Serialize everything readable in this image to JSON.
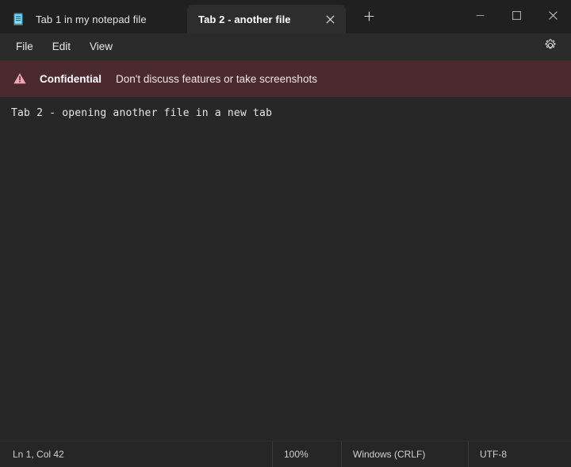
{
  "window": {
    "app_icon": "notepad-icon",
    "controls": {
      "minimize": "minimize-icon",
      "maximize": "maximize-icon",
      "close": "close-icon"
    }
  },
  "tabs": {
    "items": [
      {
        "label": "Tab 1 in my notepad file",
        "active": false
      },
      {
        "label": "Tab 2 - another file",
        "active": true
      }
    ],
    "close_icon": "close-icon",
    "new_tab_icon": "plus-icon",
    "new_tab_label": "+"
  },
  "menubar": {
    "items": [
      {
        "label": "File"
      },
      {
        "label": "Edit"
      },
      {
        "label": "View"
      }
    ],
    "settings_icon": "gear-icon"
  },
  "banner": {
    "icon": "warning-triangle-icon",
    "title": "Confidential",
    "message": "Don't discuss features or take screenshots",
    "background_color": "#4a2a2e",
    "icon_color": "#f3a6b2"
  },
  "editor": {
    "content": "Tab 2 - opening another file in a new tab"
  },
  "statusbar": {
    "position": "Ln 1, Col 42",
    "zoom": "100%",
    "line_ending": "Windows (CRLF)",
    "encoding": "UTF-8"
  }
}
